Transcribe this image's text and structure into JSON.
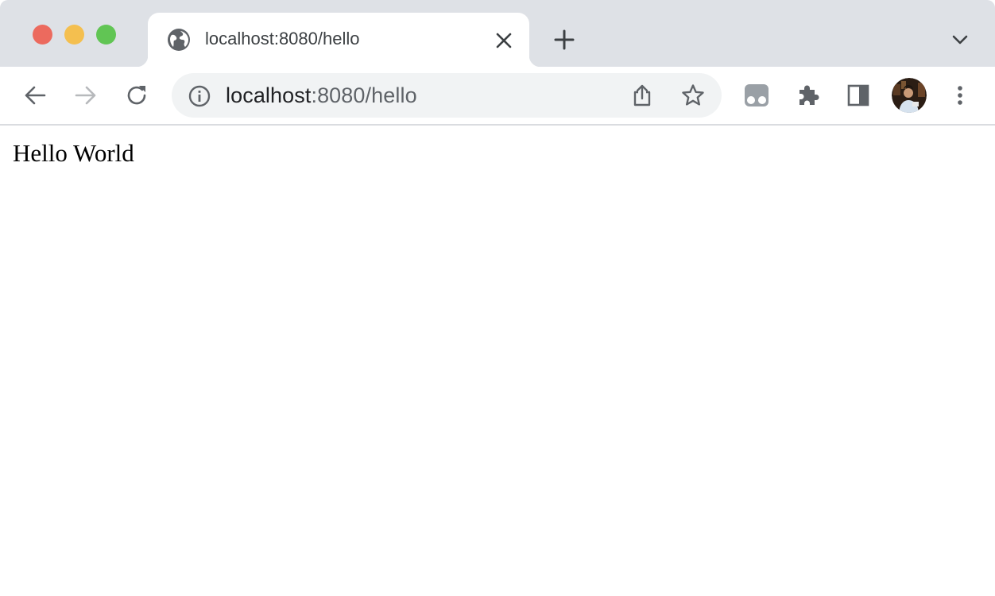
{
  "tab": {
    "title": "localhost:8080/hello"
  },
  "address_bar": {
    "host": "localhost",
    "rest": ":8080/hello"
  },
  "page": {
    "text": "Hello World"
  },
  "icons": {
    "favicon": "globe-icon",
    "tab_close": "close-icon",
    "new_tab": "plus-icon",
    "tab_search": "chevron-down-icon",
    "back": "arrow-left-icon",
    "forward": "arrow-right-icon",
    "reload": "reload-icon",
    "site_info": "info-icon",
    "share": "share-icon",
    "bookmark": "star-icon",
    "extension_1": "extension-icon",
    "extensions_menu": "puzzle-icon",
    "side_panel": "side-panel-icon",
    "profile": "avatar",
    "menu": "kebab-menu-icon"
  },
  "colors": {
    "tabstrip_bg": "#dee1e6",
    "traffic_close": "#ec6a5e",
    "traffic_minimize": "#f4bf4f",
    "traffic_maximize": "#61c554",
    "omnibox_bg": "#f1f3f4",
    "icon": "#5f6368"
  }
}
